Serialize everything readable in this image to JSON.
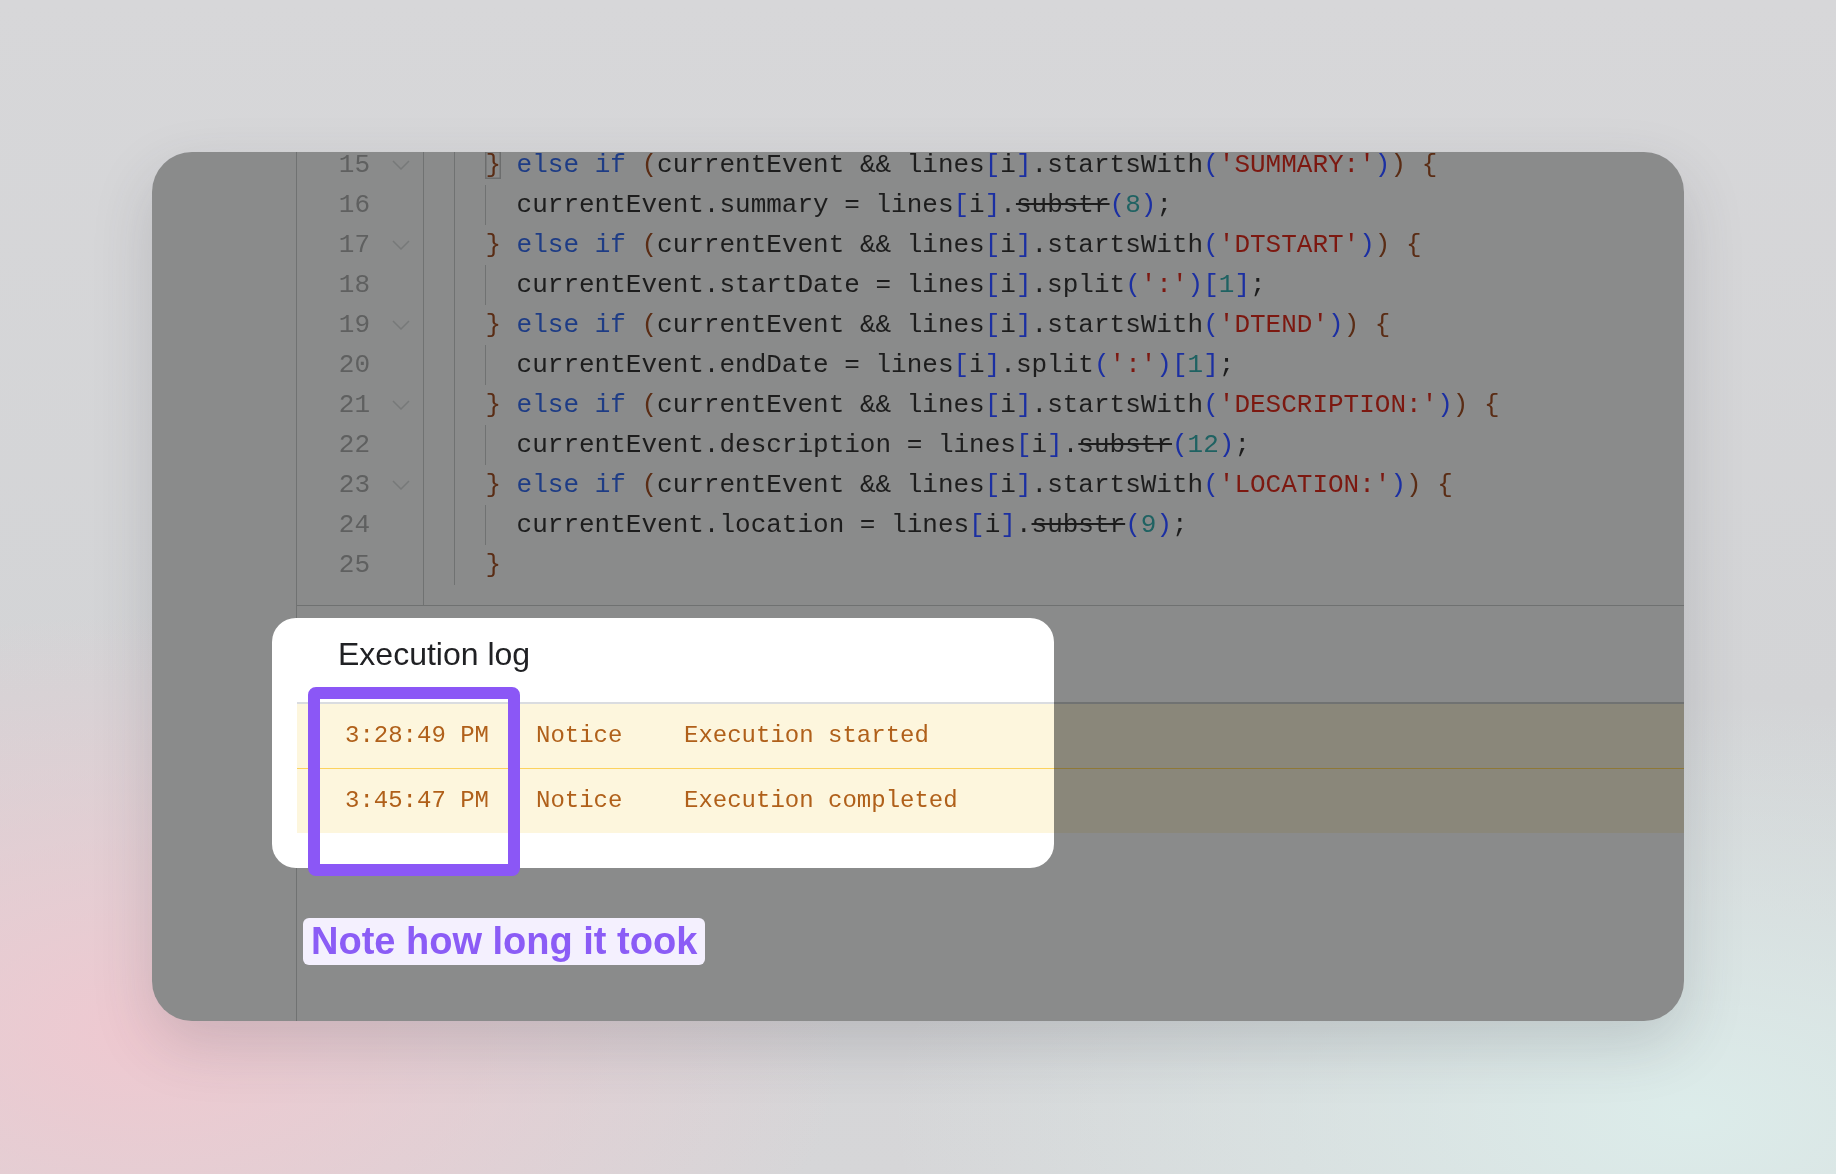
{
  "editor": {
    "lines": [
      {
        "number": "15",
        "foldable": true,
        "bracket_match": true,
        "tokens": [
          {
            "kind": "brace",
            "text": "}"
          },
          {
            "kind": "keyword",
            "text": " else if"
          },
          {
            "kind": "brace",
            "text": " ("
          },
          {
            "kind": "plain",
            "text": "currentEvent && lines"
          },
          {
            "kind": "bracket",
            "text": "["
          },
          {
            "kind": "plain",
            "text": "i"
          },
          {
            "kind": "bracket",
            "text": "]"
          },
          {
            "kind": "plain",
            "text": ".startsWith"
          },
          {
            "kind": "bracket",
            "text": "("
          },
          {
            "kind": "string",
            "text": "'SUMMARY:'"
          },
          {
            "kind": "bracket",
            "text": ")"
          },
          {
            "kind": "brace",
            "text": ") {"
          }
        ],
        "children": [
          {
            "number": "16",
            "foldable": false,
            "bracket_match": false,
            "tokens": [
              {
                "kind": "plain",
                "text": "currentEvent.summary = lines"
              },
              {
                "kind": "bracket",
                "text": "["
              },
              {
                "kind": "plain",
                "text": "i"
              },
              {
                "kind": "bracket",
                "text": "]"
              },
              {
                "kind": "plain",
                "text": "."
              },
              {
                "kind": "deprecated",
                "text": "substr"
              },
              {
                "kind": "bracket",
                "text": "("
              },
              {
                "kind": "number",
                "text": "8"
              },
              {
                "kind": "bracket",
                "text": ")"
              },
              {
                "kind": "plain",
                "text": ";"
              }
            ]
          }
        ]
      },
      {
        "number": "17",
        "foldable": true,
        "bracket_match": false,
        "tokens": [
          {
            "kind": "brace",
            "text": "}"
          },
          {
            "kind": "keyword",
            "text": " else if"
          },
          {
            "kind": "brace",
            "text": " ("
          },
          {
            "kind": "plain",
            "text": "currentEvent && lines"
          },
          {
            "kind": "bracket",
            "text": "["
          },
          {
            "kind": "plain",
            "text": "i"
          },
          {
            "kind": "bracket",
            "text": "]"
          },
          {
            "kind": "plain",
            "text": ".startsWith"
          },
          {
            "kind": "bracket",
            "text": "("
          },
          {
            "kind": "string",
            "text": "'DTSTART'"
          },
          {
            "kind": "bracket",
            "text": ")"
          },
          {
            "kind": "brace",
            "text": ") {"
          }
        ],
        "children": [
          {
            "number": "18",
            "foldable": false,
            "bracket_match": false,
            "tokens": [
              {
                "kind": "plain",
                "text": "currentEvent.startDate = lines"
              },
              {
                "kind": "bracket",
                "text": "["
              },
              {
                "kind": "plain",
                "text": "i"
              },
              {
                "kind": "bracket",
                "text": "]"
              },
              {
                "kind": "plain",
                "text": ".split"
              },
              {
                "kind": "bracket",
                "text": "("
              },
              {
                "kind": "string",
                "text": "':'"
              },
              {
                "kind": "bracket",
                "text": ")"
              },
              {
                "kind": "bracket",
                "text": "["
              },
              {
                "kind": "number",
                "text": "1"
              },
              {
                "kind": "bracket",
                "text": "]"
              },
              {
                "kind": "plain",
                "text": ";"
              }
            ]
          }
        ]
      },
      {
        "number": "19",
        "foldable": true,
        "bracket_match": false,
        "tokens": [
          {
            "kind": "brace",
            "text": "}"
          },
          {
            "kind": "keyword",
            "text": " else if"
          },
          {
            "kind": "brace",
            "text": " ("
          },
          {
            "kind": "plain",
            "text": "currentEvent && lines"
          },
          {
            "kind": "bracket",
            "text": "["
          },
          {
            "kind": "plain",
            "text": "i"
          },
          {
            "kind": "bracket",
            "text": "]"
          },
          {
            "kind": "plain",
            "text": ".startsWith"
          },
          {
            "kind": "bracket",
            "text": "("
          },
          {
            "kind": "string",
            "text": "'DTEND'"
          },
          {
            "kind": "bracket",
            "text": ")"
          },
          {
            "kind": "brace",
            "text": ") {"
          }
        ],
        "children": [
          {
            "number": "20",
            "foldable": false,
            "bracket_match": false,
            "tokens": [
              {
                "kind": "plain",
                "text": "currentEvent.endDate = lines"
              },
              {
                "kind": "bracket",
                "text": "["
              },
              {
                "kind": "plain",
                "text": "i"
              },
              {
                "kind": "bracket",
                "text": "]"
              },
              {
                "kind": "plain",
                "text": ".split"
              },
              {
                "kind": "bracket",
                "text": "("
              },
              {
                "kind": "string",
                "text": "':'"
              },
              {
                "kind": "bracket",
                "text": ")"
              },
              {
                "kind": "bracket",
                "text": "["
              },
              {
                "kind": "number",
                "text": "1"
              },
              {
                "kind": "bracket",
                "text": "]"
              },
              {
                "kind": "plain",
                "text": ";"
              }
            ]
          }
        ]
      },
      {
        "number": "21",
        "foldable": true,
        "bracket_match": false,
        "tokens": [
          {
            "kind": "brace",
            "text": "}"
          },
          {
            "kind": "keyword",
            "text": " else if"
          },
          {
            "kind": "brace",
            "text": " ("
          },
          {
            "kind": "plain",
            "text": "currentEvent && lines"
          },
          {
            "kind": "bracket",
            "text": "["
          },
          {
            "kind": "plain",
            "text": "i"
          },
          {
            "kind": "bracket",
            "text": "]"
          },
          {
            "kind": "plain",
            "text": ".startsWith"
          },
          {
            "kind": "bracket",
            "text": "("
          },
          {
            "kind": "string",
            "text": "'DESCRIPTION:'"
          },
          {
            "kind": "bracket",
            "text": ")"
          },
          {
            "kind": "brace",
            "text": ") {"
          }
        ],
        "children": [
          {
            "number": "22",
            "foldable": false,
            "bracket_match": false,
            "tokens": [
              {
                "kind": "plain",
                "text": "currentEvent.description = lines"
              },
              {
                "kind": "bracket",
                "text": "["
              },
              {
                "kind": "plain",
                "text": "i"
              },
              {
                "kind": "bracket",
                "text": "]"
              },
              {
                "kind": "plain",
                "text": "."
              },
              {
                "kind": "deprecated",
                "text": "substr"
              },
              {
                "kind": "bracket",
                "text": "("
              },
              {
                "kind": "number",
                "text": "12"
              },
              {
                "kind": "bracket",
                "text": ")"
              },
              {
                "kind": "plain",
                "text": ";"
              }
            ]
          }
        ]
      },
      {
        "number": "23",
        "foldable": true,
        "bracket_match": false,
        "tokens": [
          {
            "kind": "brace",
            "text": "}"
          },
          {
            "kind": "keyword",
            "text": " else if"
          },
          {
            "kind": "brace",
            "text": " ("
          },
          {
            "kind": "plain",
            "text": "currentEvent && lines"
          },
          {
            "kind": "bracket",
            "text": "["
          },
          {
            "kind": "plain",
            "text": "i"
          },
          {
            "kind": "bracket",
            "text": "]"
          },
          {
            "kind": "plain",
            "text": ".startsWith"
          },
          {
            "kind": "bracket",
            "text": "("
          },
          {
            "kind": "string",
            "text": "'LOCATION:'"
          },
          {
            "kind": "bracket",
            "text": ")"
          },
          {
            "kind": "brace",
            "text": ") {"
          }
        ],
        "children": [
          {
            "number": "24",
            "foldable": false,
            "bracket_match": false,
            "tokens": [
              {
                "kind": "plain",
                "text": "currentEvent.location = lines"
              },
              {
                "kind": "bracket",
                "text": "["
              },
              {
                "kind": "plain",
                "text": "i"
              },
              {
                "kind": "bracket",
                "text": "]"
              },
              {
                "kind": "plain",
                "text": "."
              },
              {
                "kind": "deprecated",
                "text": "substr"
              },
              {
                "kind": "bracket",
                "text": "("
              },
              {
                "kind": "number",
                "text": "9"
              },
              {
                "kind": "bracket",
                "text": ")"
              },
              {
                "kind": "plain",
                "text": ";"
              }
            ]
          }
        ]
      },
      {
        "number": "25",
        "foldable": false,
        "bracket_match": false,
        "tokens": [
          {
            "kind": "brace",
            "text": "}"
          }
        ]
      }
    ]
  },
  "execution_log": {
    "title": "Execution log",
    "rows": [
      {
        "time": "3:28:49 PM",
        "level": "Notice",
        "message": "Execution started"
      },
      {
        "time": "3:45:47 PM",
        "level": "Notice",
        "message": "Execution completed"
      }
    ]
  },
  "annotation": {
    "note": "Note how long it took"
  }
}
